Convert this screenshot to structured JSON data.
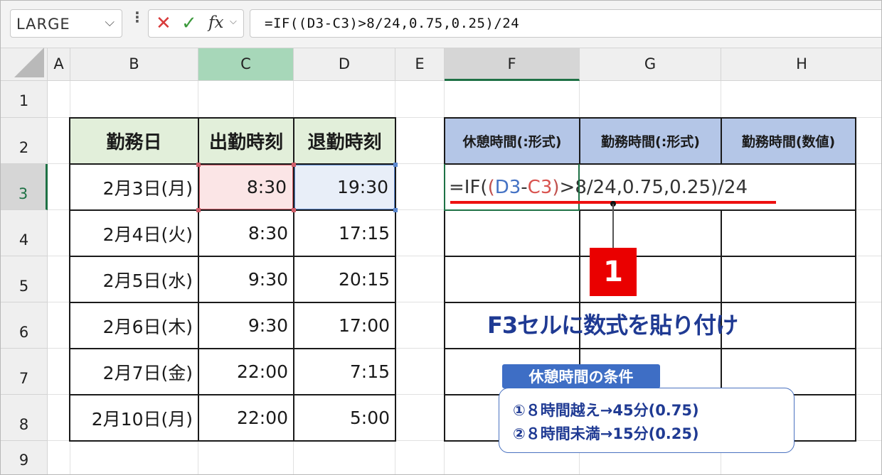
{
  "formula_bar": {
    "name_box": "LARGE",
    "name_box_dropdown": "⌵",
    "more_dots": "⋮",
    "cancel_icon": "✕",
    "enter_icon": "✓",
    "fx_label": "fx",
    "fx_dropdown": "⌵",
    "formula": "=IF((D3-C3)>8/24,0.75,0.25)/24"
  },
  "columns": [
    "A",
    "B",
    "C",
    "D",
    "E",
    "F",
    "G",
    "H"
  ],
  "rows": [
    "1",
    "2",
    "3",
    "4",
    "5",
    "6",
    "7",
    "8",
    "9"
  ],
  "left_table": {
    "headers": [
      "勤務日",
      "出勤時刻",
      "退勤時刻"
    ],
    "rows": [
      {
        "date": "2月3日(月)",
        "in": "8:30",
        "out": "19:30"
      },
      {
        "date": "2月4日(火)",
        "in": "8:30",
        "out": "17:15"
      },
      {
        "date": "2月5日(水)",
        "in": "9:30",
        "out": "20:15"
      },
      {
        "date": "2月6日(木)",
        "in": "9:30",
        "out": "17:00"
      },
      {
        "date": "2月7日(金)",
        "in": "22:00",
        "out": "7:15"
      },
      {
        "date": "2月10日(月)",
        "in": "22:00",
        "out": "5:00"
      }
    ]
  },
  "right_table": {
    "headers": [
      "休憩時間(:形式)",
      "勤務時間(:形式)",
      "勤務時間(数値)"
    ],
    "f3_formula_parts": {
      "prefix": "=IF(",
      "open_paren": "(",
      "ref_d": "D3",
      "minus": "-",
      "ref_c": "C3",
      "close_paren": ")",
      "suffix": ">8/24,0.75,0.25)/24"
    }
  },
  "annotation": {
    "step_number": "1",
    "caption": "F3セルに数式を貼り付け",
    "condition_title": "休憩時間の条件",
    "condition_lines": [
      "①８時間越え→45分(0.75)",
      "②８時間未満→15分(0.25)"
    ]
  },
  "colors": {
    "selected_column_header": "#a7d7b9",
    "header_fill_green": "#e2efda",
    "header_fill_blue": "#b4c6e7",
    "ref_d_color": "#4472c4",
    "ref_c_color": "#d9534f",
    "badge_red": "#ea0000",
    "caption_navy": "#1f3a93"
  }
}
